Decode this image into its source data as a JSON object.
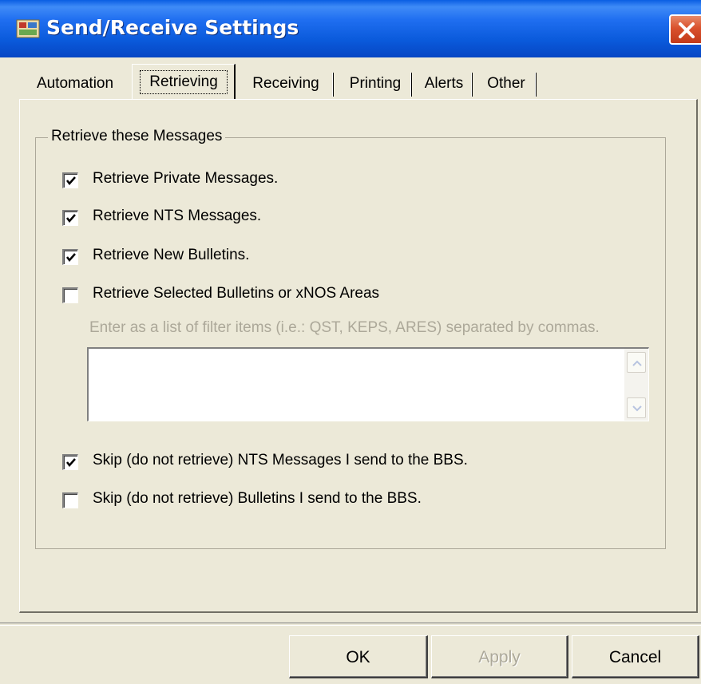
{
  "window": {
    "title": "Send/Receive Settings"
  },
  "tabs": [
    {
      "label": "Automation"
    },
    {
      "label": "Retrieving"
    },
    {
      "label": "Receiving"
    },
    {
      "label": "Printing"
    },
    {
      "label": "Alerts"
    },
    {
      "label": "Other"
    }
  ],
  "active_tab": "Retrieving",
  "group": {
    "title": "Retrieve these Messages",
    "options": [
      {
        "label": "Retrieve Private Messages.",
        "checked": true
      },
      {
        "label": "Retrieve NTS Messages.",
        "checked": true
      },
      {
        "label": "Retrieve New Bulletins.",
        "checked": true
      },
      {
        "label": "Retrieve Selected Bulletins or xNOS Areas",
        "checked": false
      }
    ],
    "filter_hint": "Enter as a list of filter items (i.e.: QST, KEPS, ARES) separated by commas.",
    "filter_value": "",
    "skip_options": [
      {
        "label": "Skip (do not retrieve) NTS Messages I send to the BBS.",
        "checked": true
      },
      {
        "label": "Skip (do not retrieve) Bulletins I send to the BBS.",
        "checked": false
      }
    ]
  },
  "buttons": {
    "ok": "OK",
    "apply": "Apply",
    "cancel": "Cancel"
  },
  "icons": {
    "app": "app-icon",
    "close": "close-icon",
    "check": "check-icon"
  },
  "colors": {
    "titlebar": "#0a5adb",
    "window_bg": "#ece9d8",
    "close_button": "#d9512d",
    "disabled_text": "#aca899"
  }
}
